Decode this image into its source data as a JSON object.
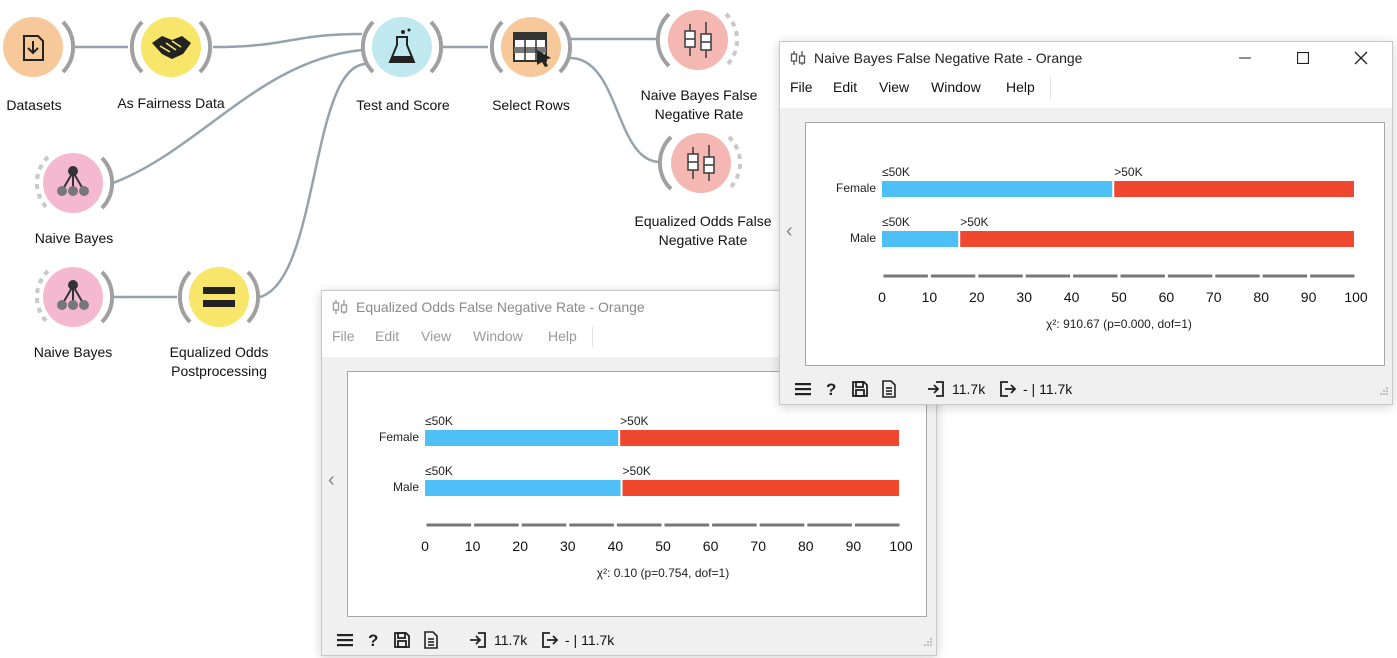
{
  "workflow": {
    "nodes": {
      "datasets": "Datasets",
      "as_fairness_data": "As Fairness Data",
      "naive_bayes_1": "Naive Bayes",
      "naive_bayes_2": "Naive Bayes",
      "equalized_odds_line1": "Equalized Odds",
      "equalized_odds_line2": "Postprocessing",
      "test_and_score": "Test and Score",
      "select_rows": "Select Rows",
      "nb_fnr_line1": "Naive Bayes False",
      "nb_fnr_line2": "Negative Rate",
      "eo_fnr_line1": "Equalized Odds False",
      "eo_fnr_line2": "Negative Rate"
    },
    "colors": {
      "data_node": "#f6c89a",
      "transform_node": "#f7e66a",
      "model_node": "#f4b8cf",
      "evaluate_node": "#bfe9ee",
      "select_node": "#f6c89a",
      "vis_node": "#f4b7b1",
      "link": "#94a3ae"
    }
  },
  "window_back": {
    "title": "Equalized Odds False Negative Rate - Orange",
    "menu": [
      "File",
      "Edit",
      "View",
      "Window",
      "Help"
    ],
    "status": {
      "in_count": "11.7k",
      "out_count": "- | 11.7k"
    }
  },
  "window_front": {
    "title": "Naive Bayes False Negative Rate - Orange",
    "menu": [
      "File",
      "Edit",
      "View",
      "Window",
      "Help"
    ],
    "status": {
      "in_count": "11.7k",
      "out_count": "- | 11.7k"
    }
  },
  "chart_data": [
    {
      "type": "bar",
      "title": "",
      "orientation": "horizontal-stacked-percent",
      "categories": [
        "Female",
        "Male"
      ],
      "series": [
        {
          "name": "≤50K",
          "values": [
            41,
            41.5
          ],
          "color": "#4fc0f5"
        },
        {
          "name": ">50K",
          "values": [
            59,
            58.5
          ],
          "color": "#f0472f"
        }
      ],
      "xticks": [
        "0",
        "10",
        "20",
        "30",
        "40",
        "50",
        "60",
        "70",
        "80",
        "90",
        "100"
      ],
      "xlim": [
        0,
        100
      ],
      "annotation": "χ²: 0.10 (p=0.754, dof=1)"
    },
    {
      "type": "bar",
      "title": "",
      "orientation": "horizontal-stacked-percent",
      "categories": [
        "Female",
        "Male"
      ],
      "series": [
        {
          "name": "≤50K",
          "values": [
            49,
            16.5
          ],
          "color": "#4fc0f5"
        },
        {
          "name": ">50K",
          "values": [
            51,
            83.5
          ],
          "color": "#f0472f"
        }
      ],
      "xticks": [
        "0",
        "10",
        "20",
        "30",
        "40",
        "50",
        "60",
        "70",
        "80",
        "90",
        "100"
      ],
      "xlim": [
        0,
        100
      ],
      "annotation": "χ²: 910.67 (p=0.000, dof=1)"
    }
  ]
}
